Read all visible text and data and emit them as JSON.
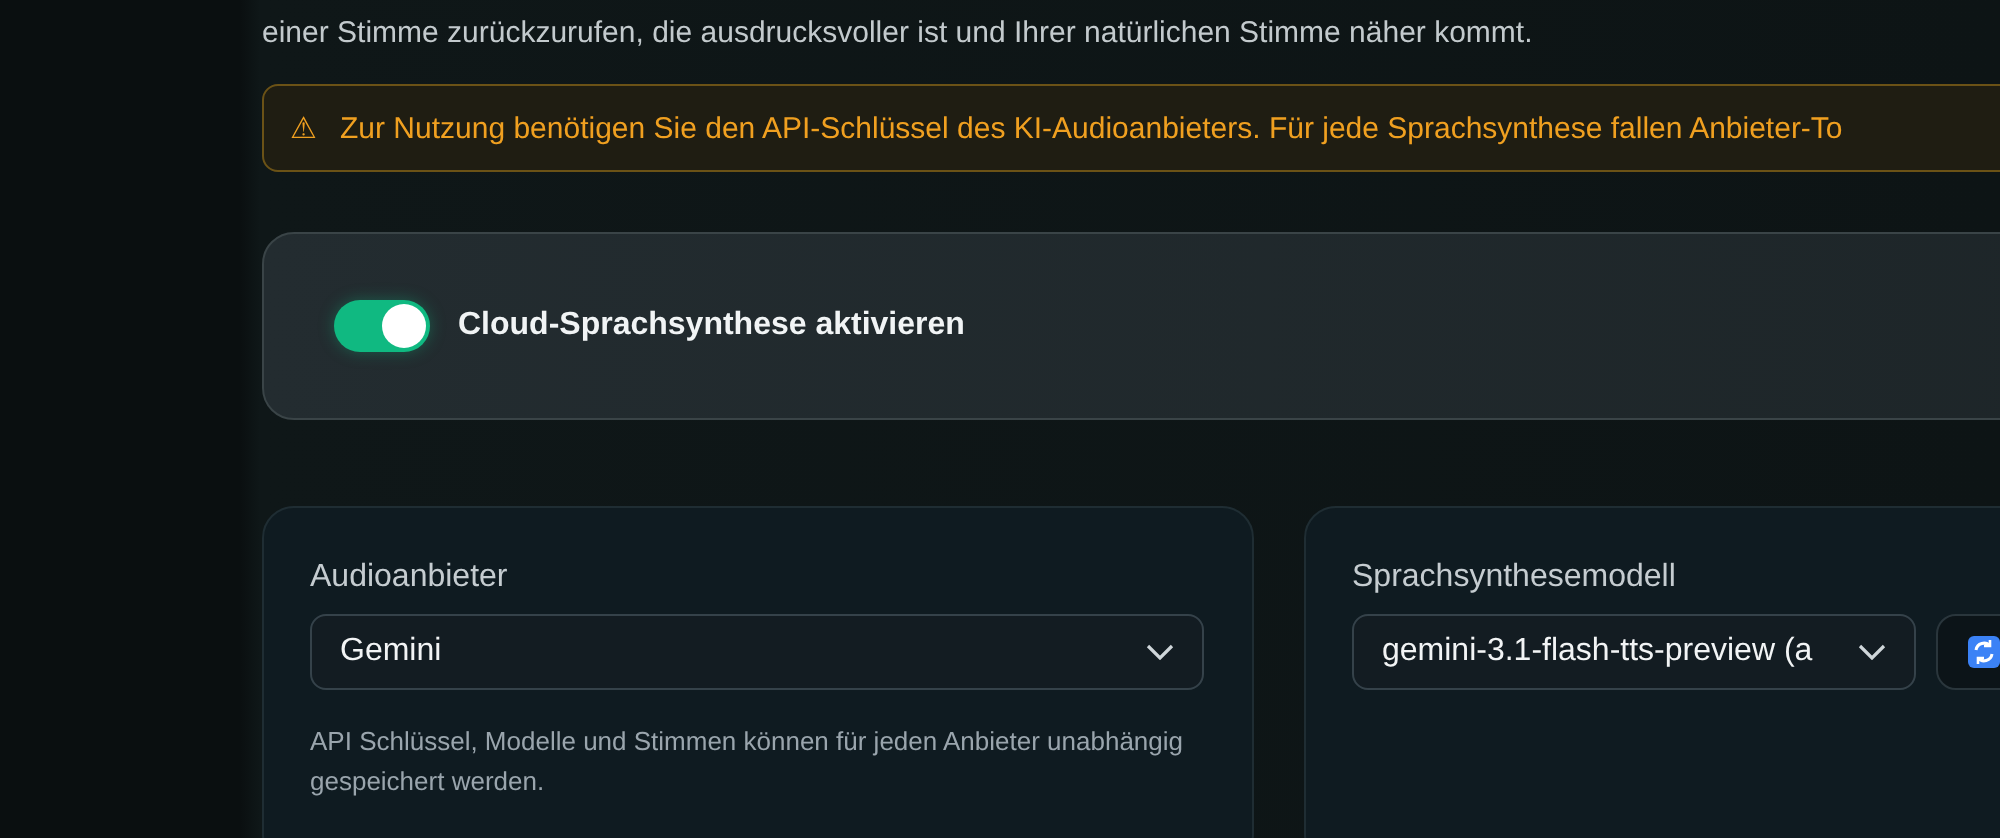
{
  "intro": {
    "text": "einer Stimme zurückzurufen, die ausdrucksvoller ist und Ihrer natürlichen Stimme näher kommt."
  },
  "warning": {
    "icon": "⚠",
    "text": "Zur Nutzung benötigen Sie den API-Schlüssel des KI-Audioanbieters. Für jede Sprachsynthese fallen Anbieter-To"
  },
  "cloud_toggle": {
    "label": "Cloud-Sprachsynthese aktivieren",
    "on": true
  },
  "provider": {
    "label": "Audioanbieter",
    "value": "Gemini",
    "help": "API Schlüssel, Modelle und Stimmen können für jeden Anbieter unabhängig gespeichert werden."
  },
  "model": {
    "label": "Sprachsynthesemodell",
    "value": "gemini-3.1-flash-tts-preview (a"
  }
}
